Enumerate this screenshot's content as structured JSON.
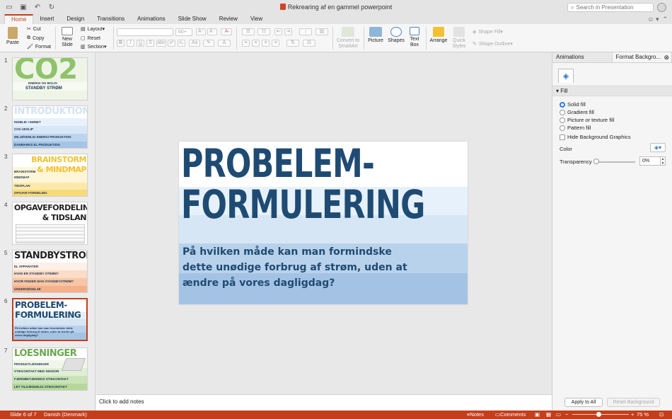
{
  "window": {
    "title": "Rekrearing af en gammel powerpoint",
    "search_placeholder": "Search in Presentation"
  },
  "tabs": [
    "Home",
    "Insert",
    "Design",
    "Transitions",
    "Animations",
    "Slide Show",
    "Review",
    "View"
  ],
  "active_tab": "Home",
  "ribbon": {
    "paste": "Paste",
    "cut": "Cut",
    "copy": "Copy",
    "format": "Format",
    "new_slide_1": "New",
    "new_slide_2": "Slide",
    "layout": "Layout",
    "reset": "Reset",
    "section": "Section",
    "font_size": "60+",
    "convert_1": "Convert to",
    "convert_2": "SmartArt",
    "picture": "Picture",
    "shapes": "Shapes",
    "textbox_1": "Text",
    "textbox_2": "Box",
    "arrange": "Arrange",
    "quick_1": "Quick",
    "quick_2": "Styles",
    "shape_fill": "Shape Fill",
    "shape_outline": "Shape Outline"
  },
  "thumbnails": [
    {
      "num": "1",
      "title": "CO2",
      "lines": [
        "ENERGI OG BOLIG",
        "STANDBY STRØM"
      ]
    },
    {
      "num": "2",
      "title": "INTRODUKTION",
      "lines": [
        "INDBLIK I EMNET",
        "CO2 UDSLIP",
        "MILJØVENLIG ENERGI PRODUKTION",
        "DANMARKS EL PRODUKTION"
      ]
    },
    {
      "num": "3",
      "title": "BRAINSTORM & MINDMAP",
      "lines": [
        "BRAINSTORM",
        "MINDMAP",
        "TIDSPLAN",
        "OPGAVE FORDELING"
      ]
    },
    {
      "num": "4",
      "title": "OPGAVEFORDELING & TIDSLAN",
      "lines": []
    },
    {
      "num": "5",
      "title": "STANDBYSTROEM",
      "lines": [
        "EL APPARATER",
        "HVAD ER STANDBY STRØM?",
        "HVOR FINDER MAN STANDBYSTRØM?",
        "UNDERSØGELSE"
      ]
    },
    {
      "num": "6",
      "title": "PROBELEM- FORMULERING",
      "lines": [
        "På hvilken måde kan man formindske dette",
        "unødige forbrug af strøm, uden at ændre på",
        "vores dagligdag?"
      ]
    },
    {
      "num": "7",
      "title": "LOESNINGER",
      "lines": [
        "PRODUKTLØSNINGER",
        "STIKKONTAKT MED SENSOR",
        "FJERNBETJENINGS STIKKONTAKT",
        "LET TILGÆNGELIG STIKKONTAKT"
      ]
    }
  ],
  "slide": {
    "title": "PROBELEM-\nFORMULERING",
    "body": "På hvilken måde kan man formindske dette unødige forbrug af strøm, uden at ændre på vores dagligdag?"
  },
  "notes_placeholder": "Click to add notes",
  "pane": {
    "tab_animations": "Animations",
    "tab_format": "Format Backgro...",
    "section": "Fill",
    "options": [
      "Solid fill",
      "Gradient fill",
      "Picture or texture fill",
      "Pattern fill"
    ],
    "selected_option": "Solid fill",
    "hide_graphics": "Hide Background Graphics",
    "color_label": "Color",
    "transparency_label": "Transparency",
    "transparency_value": "0%",
    "apply_all": "Apply to All",
    "reset_bg": "Reset Background"
  },
  "status": {
    "slide_info": "Slide 6 of 7",
    "language": "Danish (Denmark)",
    "notes": "Notes",
    "comments": "Comments",
    "zoom": "75 %"
  },
  "colors": {
    "accent": "#c43e1c",
    "slide_title": "#1f4b73"
  }
}
